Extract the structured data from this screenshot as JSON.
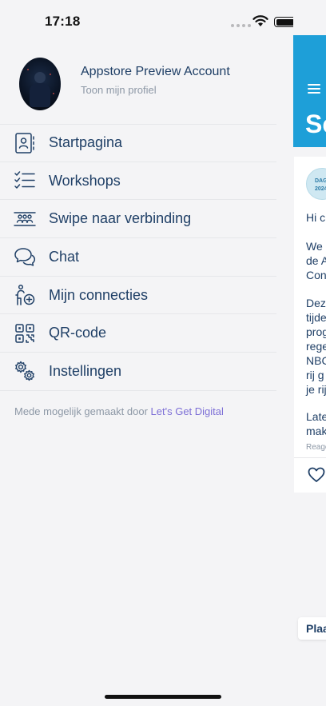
{
  "status_bar": {
    "time": "17:18"
  },
  "profile": {
    "name": "Appstore Preview Account",
    "link": "Toon mijn profiel"
  },
  "menu": {
    "items": [
      {
        "label": "Startpagina",
        "icon": "contact-book-icon"
      },
      {
        "label": "Workshops",
        "icon": "checklist-icon"
      },
      {
        "label": "Swipe naar verbinding",
        "icon": "people-group-icon"
      },
      {
        "label": "Chat",
        "icon": "chat-bubbles-icon"
      },
      {
        "label": "Mijn connecties",
        "icon": "person-add-icon"
      },
      {
        "label": "QR-code",
        "icon": "qr-code-icon"
      },
      {
        "label": "Instellingen",
        "icon": "gears-icon"
      }
    ]
  },
  "credit": {
    "prefix": "Mede mogelijk gemaakt door",
    "link": "Let's Get Digital"
  },
  "background_page": {
    "title": "Sc",
    "logo_text": [
      "DAG",
      "2024"
    ],
    "lines": [
      "Hi c",
      "We",
      "de A",
      "Con",
      "Dez",
      "tijde",
      "prog",
      "rege",
      "NBC",
      "rij g",
      "je rij",
      "Late",
      "mak"
    ],
    "meta": "Reage",
    "bottom_button": "Plaa"
  },
  "colors": {
    "accent": "#1e9fd8",
    "text": "#1f3f66",
    "muted": "#8d98a6",
    "link": "#7d6fd6",
    "background": "#f4f4f6"
  }
}
